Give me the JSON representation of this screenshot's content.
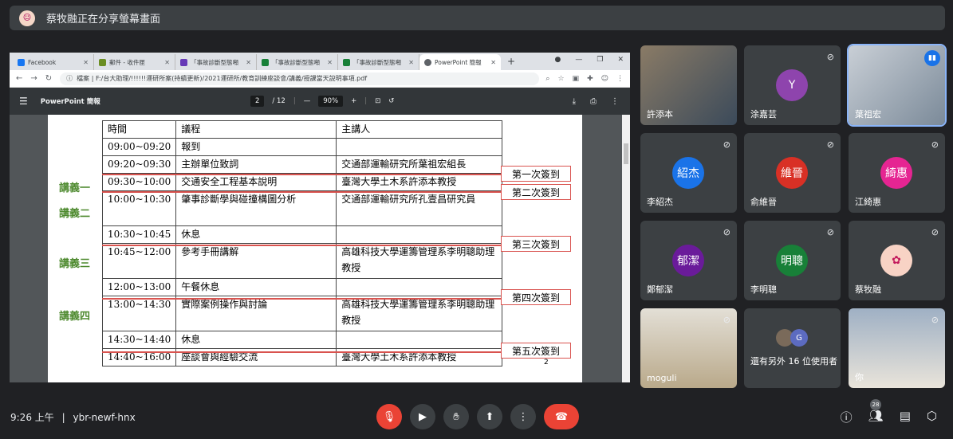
{
  "topbar": {
    "presenter_text": "蔡牧融正在分享螢幕畫面"
  },
  "browser": {
    "tabs": [
      {
        "label": "Facebook",
        "color": "#1877f2"
      },
      {
        "label": "郵件 - 收件匣",
        "color": "#6b8e23"
      },
      {
        "label": "「事故診斷型態噸",
        "color": "#673ab7"
      },
      {
        "label": "「事故診斷型態噸",
        "color": "#188038"
      },
      {
        "label": "「事故診斷型態噸",
        "color": "#188038"
      },
      {
        "label": "PowerPoint 簡報",
        "color": "#5f6368"
      }
    ],
    "url": "檔案 | F:/台大助理/!!!!!!運研所案(持續更新)/2021運研所/教育訓練座談會/講義/授課當天說明事項.pdf"
  },
  "pdf": {
    "title": "PowerPoint 簡報",
    "page_current": "2",
    "page_total": "/ 12",
    "zoom": "90%",
    "page_number": "2"
  },
  "schedule": {
    "header": [
      "時間",
      "議程",
      "主講人"
    ],
    "rows": [
      [
        "09:00~09:20",
        "報到",
        ""
      ],
      [
        "09:20~09:30",
        "主辦單位致詞",
        "交通部運輸研究所葉祖宏組長"
      ],
      [
        "09:30~10:00",
        "交通安全工程基本說明",
        "臺灣大學土木系許添本教授"
      ],
      [
        "10:00~10:30",
        "肇事診斷學與碰撞構圖分析",
        "交通部運輸研究所孔壹昌研究員"
      ],
      [
        "10:30~10:45",
        "休息",
        ""
      ],
      [
        "10:45~12:00",
        "參考手冊講解",
        "高雄科技大學運籌管理系李明聰助理教授"
      ],
      [
        "12:00~13:00",
        "午餐休息",
        ""
      ],
      [
        "13:00~14:30",
        "實際案例操作與討論",
        "高雄科技大學運籌管理系李明聰助理教授"
      ],
      [
        "14:30~14:40",
        "休息",
        ""
      ],
      [
        "14:40~16:00",
        "座談會與經驗交流",
        "臺灣大學土木系許添本教授"
      ]
    ],
    "lectures": [
      "講義一",
      "講義二",
      "講義三",
      "講義四"
    ],
    "signins": [
      "第一次簽到",
      "第二次簽到",
      "第三次簽到",
      "第四次簽到",
      "第五次簽到"
    ]
  },
  "participants": [
    {
      "name": "許添本",
      "type": "video"
    },
    {
      "name": "涂嘉芸",
      "initial": "Y",
      "color": "#8e44ad"
    },
    {
      "name": "葉祖宏",
      "type": "video"
    },
    {
      "name": "李紹杰",
      "initial": "紹杰",
      "color": "#1a73e8"
    },
    {
      "name": "俞維晉",
      "initial": "維晉",
      "color": "#d93025"
    },
    {
      "name": "江綺惠",
      "initial": "綺惠",
      "color": "#e52592"
    },
    {
      "name": "鄭郁潔",
      "initial": "郁潔",
      "color": "#6a1b9a"
    },
    {
      "name": "李明聰",
      "initial": "明聰",
      "color": "#188038"
    },
    {
      "name": "蔡牧融",
      "initial": "",
      "color": "#f8d3c5"
    },
    {
      "name": "moguli",
      "type": "video"
    },
    {
      "name": "還有另外 16 位使用者",
      "type": "others"
    },
    {
      "name": "你",
      "type": "video"
    }
  ],
  "bottom": {
    "time": "9:26 上午",
    "separator": "|",
    "meeting_code": "ybr-newf-hnx",
    "people_count": "28"
  }
}
